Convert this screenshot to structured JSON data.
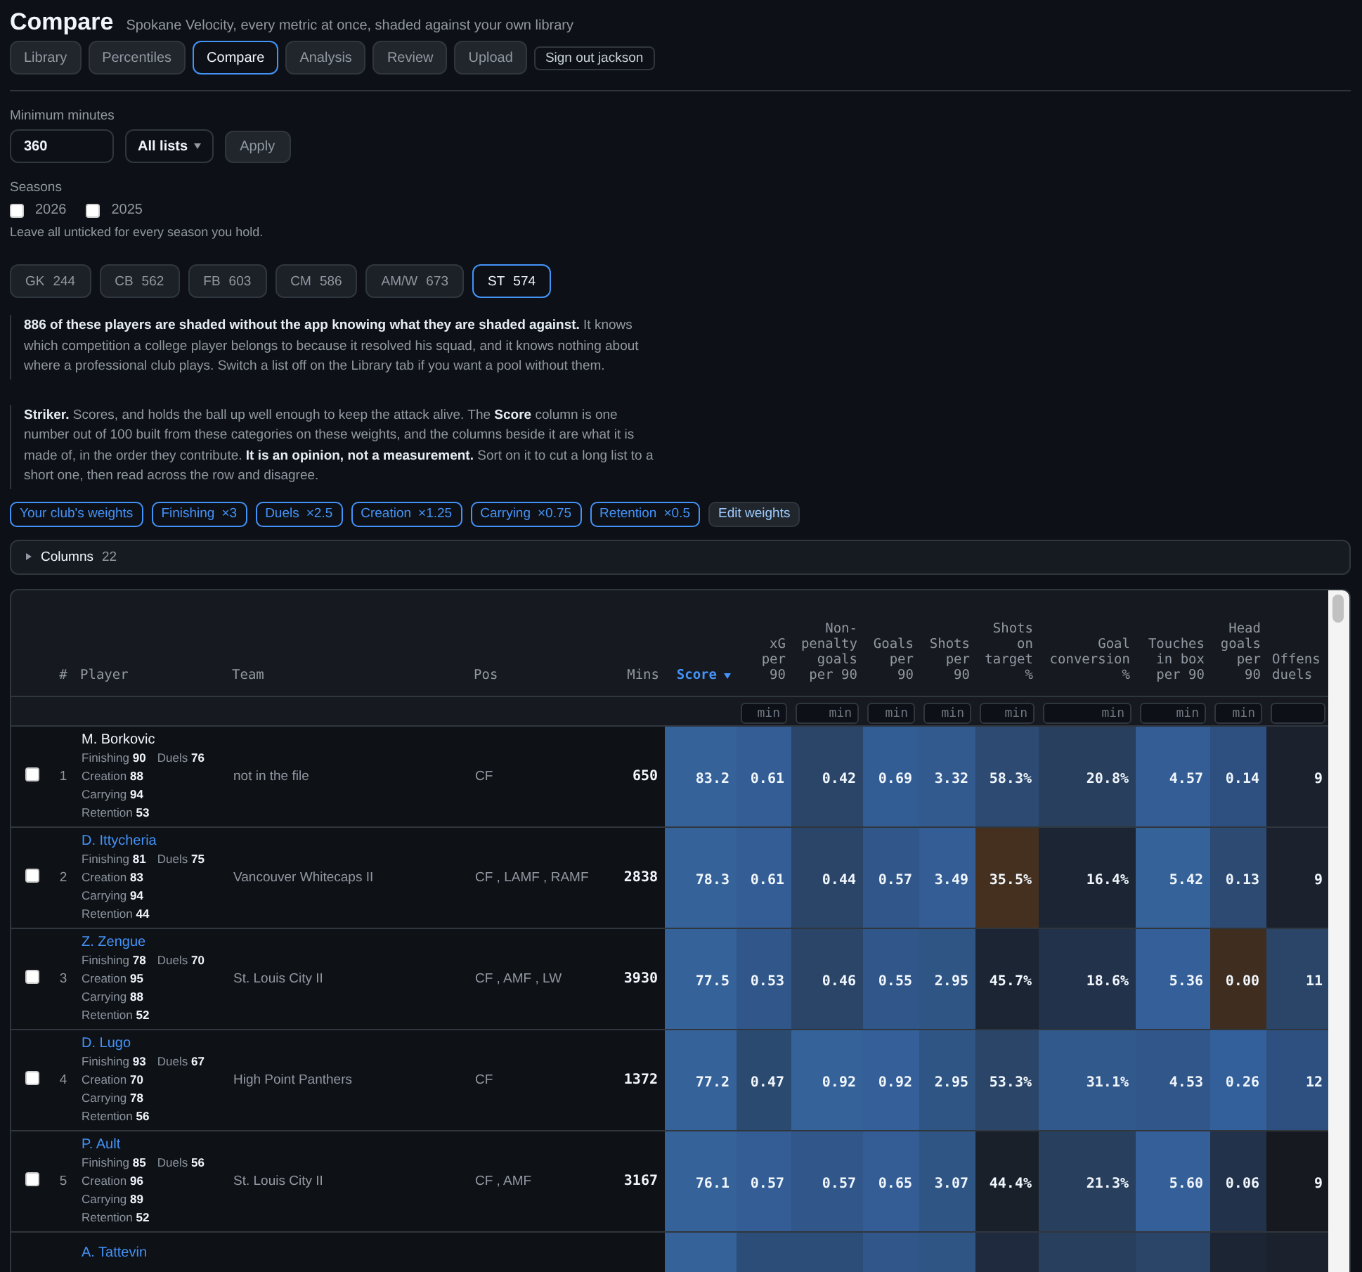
{
  "header": {
    "title": "Compare",
    "subtitle": "Spokane Velocity, every metric at once, shaded against your own library"
  },
  "tabs": [
    {
      "label": "Library",
      "selected": false
    },
    {
      "label": "Percentiles",
      "selected": false
    },
    {
      "label": "Compare",
      "selected": true
    },
    {
      "label": "Analysis",
      "selected": false
    },
    {
      "label": "Review",
      "selected": false
    },
    {
      "label": "Upload",
      "selected": false
    }
  ],
  "sign_out": "Sign out jackson",
  "filters": {
    "minutes_label": "Minimum minutes",
    "minutes_value": "360",
    "list_select": "All lists",
    "apply": "Apply",
    "seasons_label": "Seasons",
    "seasons": [
      {
        "label": "2026",
        "checked": false
      },
      {
        "label": "2025",
        "checked": false
      }
    ],
    "seasons_hint": "Leave all unticked for every season you hold."
  },
  "positions": [
    {
      "code": "GK",
      "count": "244",
      "selected": false
    },
    {
      "code": "CB",
      "count": "562",
      "selected": false
    },
    {
      "code": "FB",
      "count": "603",
      "selected": false
    },
    {
      "code": "CM",
      "count": "586",
      "selected": false
    },
    {
      "code": "AM/W",
      "count": "673",
      "selected": false
    },
    {
      "code": "ST",
      "count": "574",
      "selected": true
    }
  ],
  "notes": [
    "**886 of these players are shaded without the app knowing what they are shaded against.** It knows which competition a college player belongs to because it resolved his squad, and it knows nothing about where a professional club plays. Switch a list off on the Library tab if you want a pool without them.",
    "**Striker.** Scores, and holds the ball up well enough to keep the attack alive. The **Score** column is one number out of 100 built from these categories on these weights, and the columns beside it are what it is made of, in the order they contribute. **It is an opinion, not a measurement.** Sort on it to cut a long list to a short one, then read across the row and disagree."
  ],
  "weights": {
    "label": "Your club's weights",
    "items": [
      {
        "name": "Finishing",
        "factor": "×3"
      },
      {
        "name": "Duels",
        "factor": "×2.5"
      },
      {
        "name": "Creation",
        "factor": "×1.25"
      },
      {
        "name": "Carrying",
        "factor": "×0.75"
      },
      {
        "name": "Retention",
        "factor": "×0.5"
      }
    ],
    "edit": "Edit weights"
  },
  "columns_panel": {
    "label": "Columns",
    "count": "22",
    "expanded": false
  },
  "table": {
    "columns": [
      {
        "label": "#",
        "kind": "rank",
        "sorted": false
      },
      {
        "label": "Player",
        "kind": "player",
        "sorted": false
      },
      {
        "label": "Team",
        "kind": "text",
        "sorted": false
      },
      {
        "label": "Pos",
        "kind": "text",
        "sorted": false
      },
      {
        "label": "Mins",
        "kind": "number",
        "sorted": false
      },
      {
        "label": "Score",
        "kind": "score",
        "sorted": true
      },
      {
        "label": "xG per 90",
        "kind": "metric",
        "sorted": false,
        "filter_placeholder": "min"
      },
      {
        "label": "Non-penalty goals per 90",
        "kind": "metric",
        "sorted": false,
        "filter_placeholder": "min"
      },
      {
        "label": "Goals per 90",
        "kind": "metric",
        "sorted": false,
        "filter_placeholder": "min"
      },
      {
        "label": "Shots per 90",
        "kind": "metric",
        "sorted": false,
        "filter_placeholder": "min"
      },
      {
        "label": "Shots on target %",
        "kind": "metric",
        "sorted": false,
        "filter_placeholder": "min"
      },
      {
        "label": "Goal conversion %",
        "kind": "metric",
        "sorted": false,
        "filter_placeholder": "min"
      },
      {
        "label": "Touches in box per 90",
        "kind": "metric",
        "sorted": false,
        "filter_placeholder": "min"
      },
      {
        "label": "Head goals per 90",
        "kind": "metric",
        "sorted": false,
        "filter_placeholder": "min"
      },
      {
        "label": "Offens duels",
        "kind": "clipped",
        "sorted": false
      }
    ],
    "rows": [
      {
        "checked": false,
        "rank": "1",
        "name": "M. Borkovic",
        "link": false,
        "stat_lines": [
          [
            {
              "label": "Finishing",
              "value": "90"
            },
            {
              "label": "Duels",
              "value": "76"
            }
          ],
          [
            {
              "label": "Creation",
              "value": "88"
            }
          ],
          [
            {
              "label": "Carrying",
              "value": "94"
            }
          ],
          [
            {
              "label": "Retention",
              "value": "53"
            }
          ]
        ],
        "team": "not in the file",
        "pos": "CF",
        "mins": "650",
        "score": {
          "value": "83.2",
          "color": "#36629a"
        },
        "metrics": [
          {
            "value": "0.61",
            "color": "#335d94"
          },
          {
            "value": "0.42",
            "color": "#2a4568"
          },
          {
            "value": "0.69",
            "color": "#325d94"
          },
          {
            "value": "3.32",
            "color": "#325a8e"
          },
          {
            "value": "58.3%",
            "color": "#2c4a72"
          },
          {
            "value": "20.8%",
            "color": "#283f5e"
          },
          {
            "value": "4.57",
            "color": "#335d94"
          },
          {
            "value": "0.14",
            "color": "#2e5080"
          },
          {
            "value": "9",
            "color": "#1b222d"
          }
        ]
      },
      {
        "checked": false,
        "rank": "2",
        "name": "D. Ittycheria",
        "link": true,
        "stat_lines": [
          [
            {
              "label": "Finishing",
              "value": "81"
            },
            {
              "label": "Duels",
              "value": "75"
            }
          ],
          [
            {
              "label": "Creation",
              "value": "83"
            }
          ],
          [
            {
              "label": "Carrying",
              "value": "94"
            }
          ],
          [
            {
              "label": "Retention",
              "value": "44"
            }
          ]
        ],
        "team": "Vancouver Whitecaps II",
        "pos": "CF , LAMF , RAMF",
        "mins": "2838",
        "score": {
          "value": "78.3",
          "color": "#36629a"
        },
        "metrics": [
          {
            "value": "0.61",
            "color": "#335d94"
          },
          {
            "value": "0.44",
            "color": "#2a4568"
          },
          {
            "value": "0.57",
            "color": "#30568a"
          },
          {
            "value": "3.49",
            "color": "#335d94"
          },
          {
            "value": "35.5%",
            "color": "#45301f"
          },
          {
            "value": "16.4%",
            "color": "#1c2533"
          },
          {
            "value": "5.42",
            "color": "#36629a"
          },
          {
            "value": "0.13",
            "color": "#2c4a72"
          },
          {
            "value": "9",
            "color": "#1b222d"
          }
        ]
      },
      {
        "checked": false,
        "rank": "3",
        "name": "Z. Zengue",
        "link": true,
        "stat_lines": [
          [
            {
              "label": "Finishing",
              "value": "78"
            },
            {
              "label": "Duels",
              "value": "70"
            }
          ],
          [
            {
              "label": "Creation",
              "value": "95"
            }
          ],
          [
            {
              "label": "Carrying",
              "value": "88"
            }
          ],
          [
            {
              "label": "Retention",
              "value": "52"
            }
          ]
        ],
        "team": "St. Louis City II",
        "pos": "CF , AMF , LW",
        "mins": "3930",
        "score": {
          "value": "77.5",
          "color": "#36629a"
        },
        "metrics": [
          {
            "value": "0.53",
            "color": "#30568a"
          },
          {
            "value": "0.46",
            "color": "#2a4568"
          },
          {
            "value": "0.55",
            "color": "#30568a"
          },
          {
            "value": "2.95",
            "color": "#2f5585"
          },
          {
            "value": "45.7%",
            "color": "#1c2533"
          },
          {
            "value": "18.6%",
            "color": "#22324a"
          },
          {
            "value": "5.36",
            "color": "#355f98"
          },
          {
            "value": "0.00",
            "color": "#3f2e20"
          },
          {
            "value": "11",
            "color": "#2a4568"
          }
        ]
      },
      {
        "checked": false,
        "rank": "4",
        "name": "D. Lugo",
        "link": true,
        "stat_lines": [
          [
            {
              "label": "Finishing",
              "value": "93"
            },
            {
              "label": "Duels",
              "value": "67"
            }
          ],
          [
            {
              "label": "Creation",
              "value": "70"
            }
          ],
          [
            {
              "label": "Carrying",
              "value": "78"
            }
          ],
          [
            {
              "label": "Retention",
              "value": "56"
            }
          ]
        ],
        "team": "High Point Panthers",
        "pos": "CF",
        "mins": "1372",
        "score": {
          "value": "77.2",
          "color": "#36629a"
        },
        "metrics": [
          {
            "value": "0.47",
            "color": "#2a4a70"
          },
          {
            "value": "0.92",
            "color": "#36629a"
          },
          {
            "value": "0.92",
            "color": "#355f98"
          },
          {
            "value": "2.95",
            "color": "#2f5585"
          },
          {
            "value": "53.3%",
            "color": "#2a4568"
          },
          {
            "value": "31.1%",
            "color": "#32598c"
          },
          {
            "value": "4.53",
            "color": "#30568a"
          },
          {
            "value": "0.26",
            "color": "#33609a"
          },
          {
            "value": "12",
            "color": "#2e5080"
          }
        ]
      },
      {
        "checked": false,
        "rank": "5",
        "name": "P. Ault",
        "link": true,
        "stat_lines": [
          [
            {
              "label": "Finishing",
              "value": "85"
            },
            {
              "label": "Duels",
              "value": "56"
            }
          ],
          [
            {
              "label": "Creation",
              "value": "96"
            }
          ],
          [
            {
              "label": "Carrying",
              "value": "89"
            }
          ],
          [
            {
              "label": "Retention",
              "value": "52"
            }
          ]
        ],
        "team": "St. Louis City II",
        "pos": "CF , AMF",
        "mins": "3167",
        "score": {
          "value": "76.1",
          "color": "#36629a"
        },
        "metrics": [
          {
            "value": "0.57",
            "color": "#335d94"
          },
          {
            "value": "0.57",
            "color": "#30568a"
          },
          {
            "value": "0.65",
            "color": "#335d94"
          },
          {
            "value": "3.07",
            "color": "#2f5585"
          },
          {
            "value": "44.4%",
            "color": "#1a2029"
          },
          {
            "value": "21.3%",
            "color": "#283f5e"
          },
          {
            "value": "5.60",
            "color": "#355f98"
          },
          {
            "value": "0.06",
            "color": "#22324a"
          },
          {
            "value": "9",
            "color": "#161a20"
          }
        ]
      },
      {
        "name": "A. Tattevin",
        "link": true,
        "score": {
          "color": "#36629a"
        },
        "metrics": [
          {
            "color": "#2c4d77"
          },
          {
            "color": "#2c4d77"
          },
          {
            "color": "#30568a"
          },
          {
            "color": "#2f5585"
          },
          {
            "color": "#1f2a3e"
          },
          {
            "color": "#283f5e"
          },
          {
            "color": "#2a4568"
          },
          {
            "color": "#1c2533"
          },
          {
            "color": "#1b222d"
          }
        ]
      }
    ]
  }
}
